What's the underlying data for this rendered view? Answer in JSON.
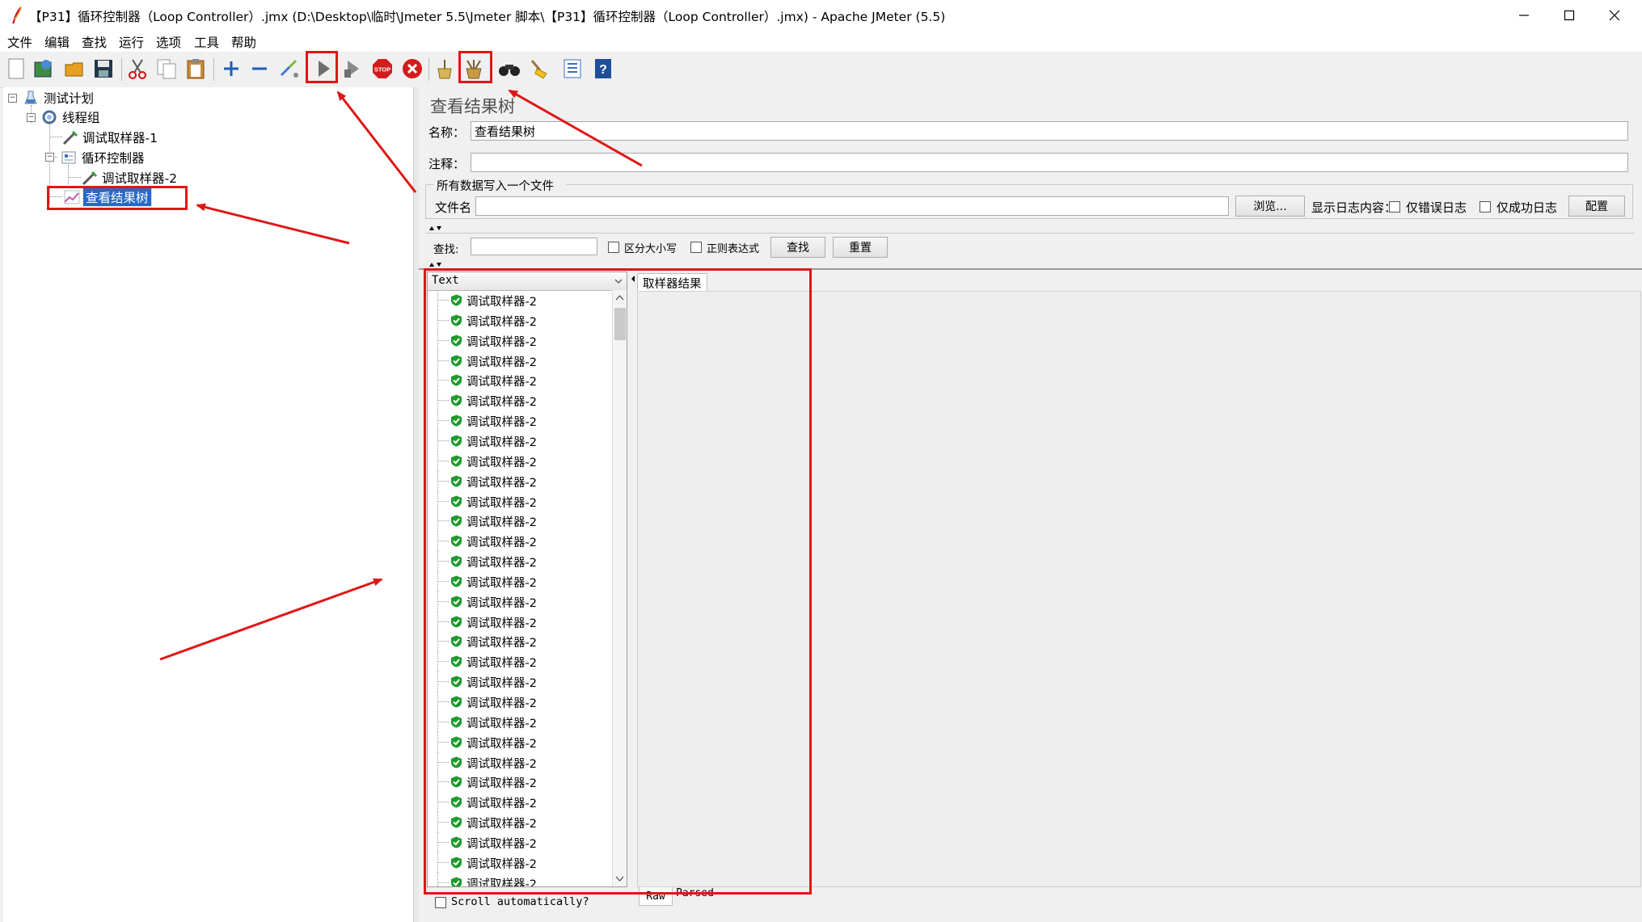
{
  "window": {
    "title": "【P31】循环控制器（Loop Controller）.jmx (D:\\Desktop\\临时\\Jmeter 5.5\\Jmeter 脚本\\【P31】循环控制器（Loop Controller）.jmx) - Apache JMeter (5.5)",
    "controls": [
      "minimize-icon",
      "maximize-icon",
      "close-icon"
    ]
  },
  "menu": [
    "文件",
    "编辑",
    "查找",
    "运行",
    "选项",
    "工具",
    "帮助"
  ],
  "toolbar": {
    "icons": [
      "new-icon",
      "templates-icon",
      "open-icon",
      "save-icon",
      "cut-icon",
      "copy-icon",
      "paste-icon",
      "expand-icon",
      "collapse-icon",
      "toggle-icon",
      "start-icon",
      "start-no-pause-icon",
      "stop-icon",
      "shutdown-icon",
      "clear-icon",
      "clear-all-icon",
      "search-icon",
      "reset-search-icon",
      "function-helper-icon",
      "help-icon"
    ],
    "accent": "#1e5eb8"
  },
  "tree": {
    "items": [
      {
        "label": "测试计划",
        "icon": "test-plan-icon"
      },
      {
        "label": "线程组",
        "icon": "thread-group-icon"
      },
      {
        "label": "调试取样器-1",
        "icon": "sampler-icon"
      },
      {
        "label": "循环控制器",
        "icon": "controller-icon"
      },
      {
        "label": "调试取样器-2",
        "icon": "sampler-icon"
      },
      {
        "label": "查看结果树",
        "icon": "listener-icon",
        "selected": true
      }
    ]
  },
  "panel": {
    "title": "查看结果树",
    "name_label": "名称：",
    "name_value": "查看结果树",
    "comment_label": "注释：",
    "comment_value": "",
    "file_group_label": "所有数据写入一个文件",
    "filename_label": "文件名",
    "filename_value": "",
    "browse_button": "浏览...",
    "log_content_label": "显示日志内容：",
    "errors_only_label": "仅错误日志",
    "success_only_label": "仅成功日志",
    "config_button": "配置",
    "search_label": "查找:",
    "search_value": "",
    "case_sensitive_label": "区分大小写",
    "regex_label": "正则表达式",
    "find_button": "查找",
    "reset_button": "重置",
    "renderer_selected": "Text",
    "result_tab": "取样器结果",
    "scroll_auto_label": "Scroll automatically?",
    "raw_tab": "Raw",
    "parsed_tab": "Parsed"
  },
  "results": {
    "item_label": "调试取样器-2",
    "status": "success",
    "visible_count": 30
  },
  "colors": {
    "highlight": "#e01616",
    "selection": "#2868c8",
    "success": "#1f9a2c"
  }
}
